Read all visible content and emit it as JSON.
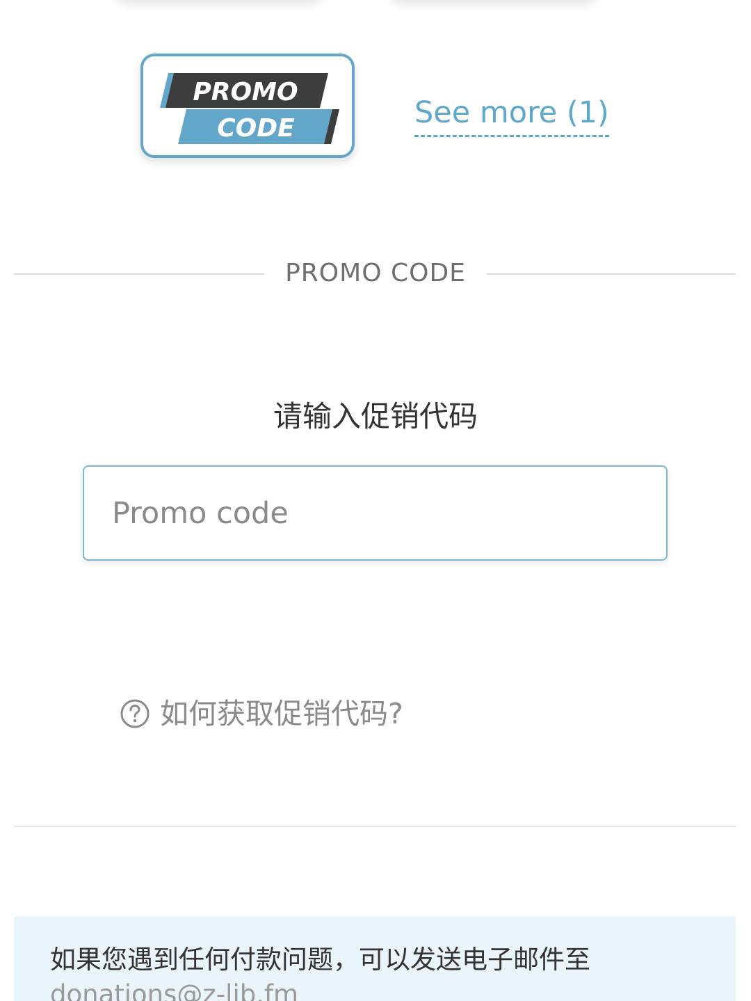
{
  "promo_badge": {
    "line1": "PROMO",
    "line2": "CODE",
    "colors": {
      "dark": "#3d3d3d",
      "blue": "#62a7c9",
      "text": "#ffffff"
    }
  },
  "see_more_label": "See more (1)",
  "section_title": "PROMO CODE",
  "prompt": "请输入促销代码",
  "promo_input": {
    "value": "",
    "placeholder": "Promo code"
  },
  "help": {
    "icon": "question-circle-icon",
    "text": "如何获取促销代码?"
  },
  "info": {
    "text": "如果您遇到任何付款问题，可以发送电子邮件至",
    "email": "donations@z-lib.fm"
  },
  "colors": {
    "accent": "#5ea8cc",
    "info_bg": "#eaf4fb",
    "muted": "#8a8a8a"
  }
}
